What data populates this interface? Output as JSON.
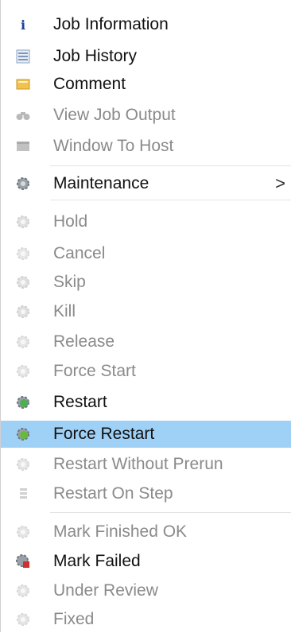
{
  "menu": {
    "items": [
      {
        "label": "Job Information",
        "icon": "info-icon",
        "enabled": true
      },
      {
        "label": "Job History",
        "icon": "history-icon",
        "enabled": true
      },
      {
        "label": "Comment",
        "icon": "comment-icon",
        "enabled": true
      },
      {
        "label": "View Job Output",
        "icon": "binoculars-icon",
        "enabled": false
      },
      {
        "label": "Window To Host",
        "icon": "window-icon",
        "enabled": false
      },
      {
        "label": "Maintenance",
        "icon": "gear-icon",
        "enabled": true,
        "submenu": true,
        "submenu_glyph": ">"
      },
      {
        "label": "Hold",
        "icon": "hold-gear-icon",
        "enabled": false
      },
      {
        "label": "Cancel",
        "icon": "cancel-gear-icon",
        "enabled": false
      },
      {
        "label": "Skip",
        "icon": "skip-gear-icon",
        "enabled": false
      },
      {
        "label": "Kill",
        "icon": "kill-gear-icon",
        "enabled": false
      },
      {
        "label": "Release",
        "icon": "release-gear-icon",
        "enabled": false
      },
      {
        "label": "Force Start",
        "icon": "force-start-gear-icon",
        "enabled": false
      },
      {
        "label": "Restart",
        "icon": "restart-gear-icon",
        "enabled": true
      },
      {
        "label": "Force Restart",
        "icon": "force-restart-gear-icon",
        "enabled": true,
        "highlighted": true
      },
      {
        "label": "Restart Without Prerun",
        "icon": "restart-without-prerun-gear-icon",
        "enabled": false
      },
      {
        "label": "Restart On Step",
        "icon": "restart-on-step-icon",
        "enabled": false
      },
      {
        "label": "Mark Finished OK",
        "icon": "mark-finished-gear-icon",
        "enabled": false
      },
      {
        "label": "Mark Failed",
        "icon": "mark-failed-gear-icon",
        "enabled": true
      },
      {
        "label": "Under Review",
        "icon": "under-review-gear-icon",
        "enabled": false
      },
      {
        "label": "Fixed",
        "icon": "fixed-gear-icon",
        "enabled": false
      }
    ]
  },
  "colors": {
    "highlight": "#9fd0f5",
    "enabled_text": "#111111",
    "disabled_text": "#8a8a8a",
    "green": "#4caf50",
    "red": "#d32f2f"
  }
}
